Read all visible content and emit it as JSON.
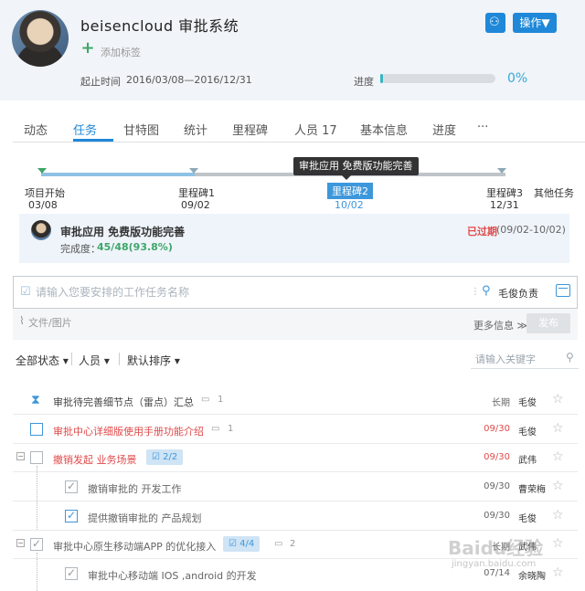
{
  "header": {
    "app_title": "beisencloud 审批系统",
    "add_tag_label": "添加标签",
    "start_time_label": "起止时间",
    "start_time_value": "2016/03/08—2016/12/31",
    "progress_label": "进度",
    "progress_value": "0%",
    "progress_fraction": 0.02,
    "action_button_label": "操作▼"
  },
  "tabs": [
    {
      "label": "动态"
    },
    {
      "label": "任务"
    },
    {
      "label": "甘特图"
    },
    {
      "label": "统计"
    },
    {
      "label": "里程碑"
    },
    {
      "label": "人员 17"
    },
    {
      "label": "基本信息"
    },
    {
      "label": "进度"
    },
    {
      "label": "···"
    }
  ],
  "milestones": {
    "tooltip": "审批应用 免费版功能完善",
    "items": [
      {
        "name": "项目开始",
        "date": "03/08"
      },
      {
        "name": "里程碑1",
        "date": "09/02"
      },
      {
        "name": "里程碑2",
        "date": "10/02"
      },
      {
        "name": "里程碑3",
        "date": "12/31"
      },
      {
        "name": "其他任务",
        "date": ""
      }
    ]
  },
  "task_card": {
    "title": "审批应用 免费版功能完善",
    "completion_label": "完成度：",
    "completion_value": "45/48(93.8%)",
    "overdue_label": "已过期",
    "date_range": "(09/02-10/02)"
  },
  "task_input": {
    "placeholder": "请输入您要安排的工作任务名称",
    "owner_label": "毛俊负责",
    "attach_label": "文件/图片",
    "more_info_label": "更多信息 ≫",
    "publish_label": "发布"
  },
  "filters": {
    "status": "全部状态 ▾",
    "people": "人员 ▾",
    "sort": "默认排序 ▾",
    "search_placeholder": "请输入关键字"
  },
  "tasks": [
    {
      "title": "审批待完善细节点（雷点）汇总",
      "comments": "1",
      "date": "长期",
      "owner": "毛俊"
    },
    {
      "title": "审批中心详细版使用手册功能介绍",
      "comments": "1",
      "date": "09/30",
      "owner": "毛俊"
    },
    {
      "title": "撤销发起 业务场景",
      "badge": "2/2",
      "date": "09/30",
      "owner": "武伟"
    },
    {
      "title": "撤销审批的 开发工作",
      "date": "09/30",
      "owner": "曹荣梅"
    },
    {
      "title": "提供撤销审批的 产品规划",
      "date": "09/30",
      "owner": "毛俊"
    },
    {
      "title": "审批中心原生移动端APP 的优化接入",
      "badge": "4/4",
      "comments": "2",
      "date": "长期",
      "owner": "武伟"
    },
    {
      "title": "审批中心移动端 IOS ,android 的开发",
      "date": "07/14",
      "owner": "余晓陶"
    }
  ],
  "watermark": {
    "main": "Baidu经验",
    "sub": "jingyan.baidu.com"
  }
}
